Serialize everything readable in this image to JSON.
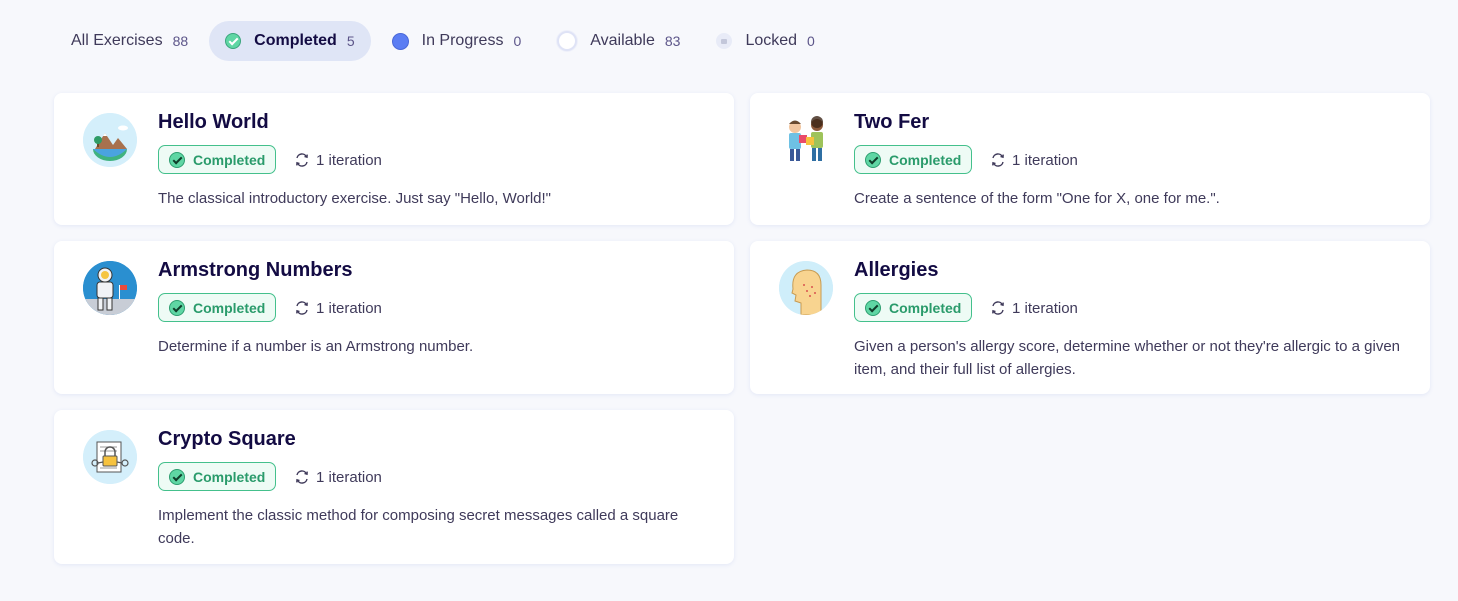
{
  "filters": [
    {
      "label": "All Exercises",
      "count": "88"
    },
    {
      "label": "Completed",
      "count": "5"
    },
    {
      "label": "In Progress",
      "count": "0"
    },
    {
      "label": "Available",
      "count": "83"
    },
    {
      "label": "Locked",
      "count": "0"
    }
  ],
  "exercises": [
    {
      "title": "Hello World",
      "status": "Completed",
      "iterations": "1 iteration",
      "description": "The classical introductory exercise. Just say \"Hello, World!\""
    },
    {
      "title": "Two Fer",
      "status": "Completed",
      "iterations": "1 iteration",
      "description": "Create a sentence of the form \"One for X, one for me.\"."
    },
    {
      "title": "Armstrong Numbers",
      "status": "Completed",
      "iterations": "1 iteration",
      "description": "Determine if a number is an Armstrong number."
    },
    {
      "title": "Allergies",
      "status": "Completed",
      "iterations": "1 iteration",
      "description": "Given a person's allergy score, determine whether or not they're allergic to a given item, and their full list of allergies."
    },
    {
      "title": "Crypto Square",
      "status": "Completed",
      "iterations": "1 iteration",
      "description": "Implement the classic method for composing secret messages called a square code."
    }
  ],
  "colors": {
    "accent": "#5b7df3",
    "completed": "#44c08c",
    "background": "#f7f8fc"
  }
}
